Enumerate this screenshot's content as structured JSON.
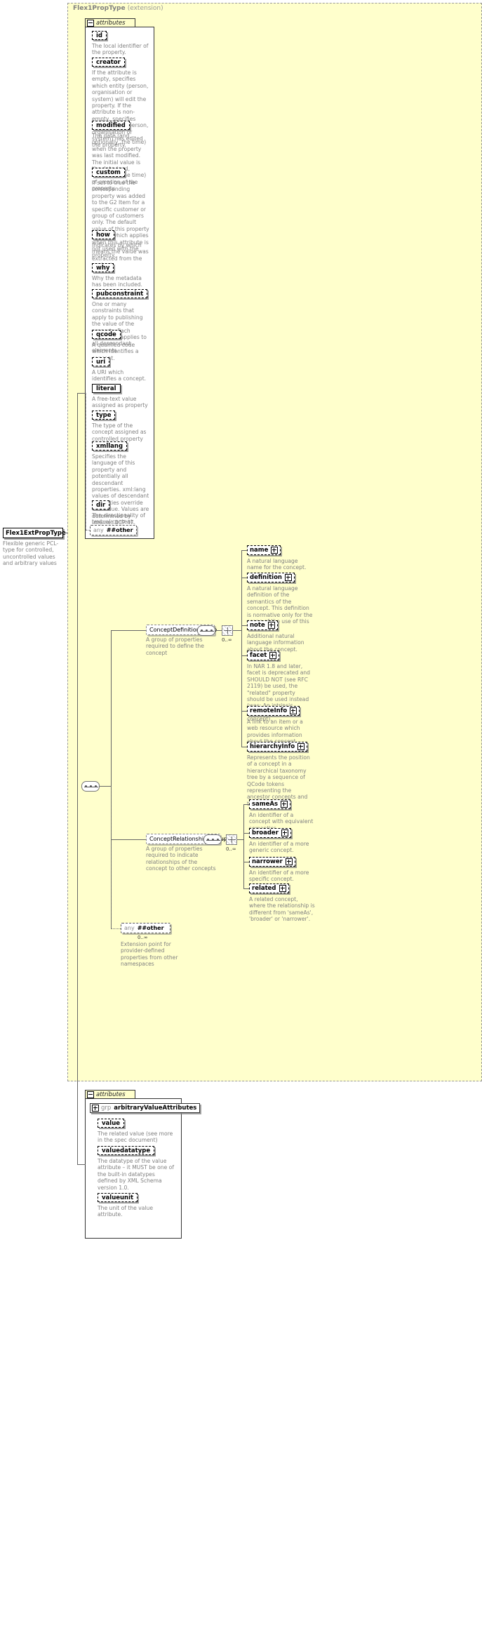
{
  "diagram": {
    "type": "xsd-schema-documentation",
    "root_type": {
      "label": "Flex1ExtPropType",
      "description": "Flexible generic PCL-type for controlled, uncontrolled values and arbitrary values"
    },
    "base_type_panel": {
      "title": "Flex1PropType",
      "qualifier": "(extension)"
    },
    "attributes_section_label": "attributes",
    "attributes": [
      {
        "name": "id",
        "description": "The local identifier of the property."
      },
      {
        "name": "creator",
        "description": "If the attribute is empty, specifies which entity (person, organisation or system) will edit the property. If the attribute is non-empty, specifies which entity (person, organisation or system) has edited the property."
      },
      {
        "name": "modified",
        "description": "The date (and, optionally, the time) when the property was last modified. The initial value is the date (and, optionally, the time) of creation of the property."
      },
      {
        "name": "custom",
        "description": "If set to true the corresponding property was added to the G2 Item for a specific customer or group of customers only. The default value of this property is false which applies when this attribute is not used with the property."
      },
      {
        "name": "how",
        "description": "Indicates by which means the value was extracted from the content."
      },
      {
        "name": "why",
        "description": "Why the metadata has been included."
      },
      {
        "name": "pubconstraint",
        "description": "One or many constraints that apply to publishing the value of the property. Each constraint applies to all descendant elements."
      },
      {
        "name": "qcode",
        "description": "A qualified code which identifies a concept."
      },
      {
        "name": "uri",
        "description": "A URI which identifies a concept."
      },
      {
        "name": "literal",
        "description": "A free-text value assigned as property value."
      },
      {
        "name": "type",
        "description": "The type of the concept assigned as controlled property value."
      },
      {
        "name": "xmllang",
        "description": "Specifies the language of this property and potentially all descendant properties. xml:lang values of descendant properties override this value. Values are determined by Internet BCP 47."
      },
      {
        "name": "dir",
        "description": "The directionality of textual content."
      }
    ],
    "attributes_any": {
      "any_label": "any",
      "namespace": "##other"
    },
    "content_model": {
      "groups": [
        {
          "name": "ConceptDefinitionGroup",
          "description": "A group of properties required to define the concept",
          "occurs": "0..∞",
          "members": [
            {
              "name": "name",
              "description": "A natural language name for the concept."
            },
            {
              "name": "definition",
              "description": "A natural language definition of the semantics of the concept. This definition is normative only for the scope of the use of this concept."
            },
            {
              "name": "note",
              "description": "Additional natural language information about the concept."
            },
            {
              "name": "facet",
              "description": "In NAR 1.8 and later, facet is deprecated and SHOULD NOT (see RFC 2119) be used, the \"related\" property should be used instead (was: An intrinsic property of the concept)."
            },
            {
              "name": "remoteInfo",
              "description": "A link to an item or a web resource which provides information about the concept"
            },
            {
              "name": "hierarchyInfo",
              "description": "Represents the position of a concept in a hierarchical taxonomy tree by a sequence of QCode tokens representing the ancestor concepts and this concept"
            }
          ]
        },
        {
          "name": "ConceptRelationshipsGroup",
          "description": "A group of properties required to indicate relationships of the concept to other concepts",
          "occurs": "0..∞",
          "members": [
            {
              "name": "sameAs",
              "description": "An identifier of a concept with equivalent semantics"
            },
            {
              "name": "broader",
              "description": "An identifier of a more generic concept."
            },
            {
              "name": "narrower",
              "description": "An identifier of a more specific concept."
            },
            {
              "name": "related",
              "description": "A related concept, where the relationship is different from 'sameAs', 'broader' or 'narrower'."
            }
          ]
        }
      ],
      "any": {
        "any_label": "any",
        "namespace": "##other",
        "occurs": "0..∞",
        "description": "Extension point for provider-defined properties from other namespaces"
      }
    },
    "bottom_attributes_section_label": "attributes",
    "attribute_group": {
      "kind_label": "grp",
      "name": "arbitraryValueAttributes",
      "attributes": [
        {
          "name": "value",
          "description": "The related value (see more in the spec document)"
        },
        {
          "name": "valuedatatype",
          "description": "The datatype of the value attribute – it MUST be one of the built-in datatypes defined by XML Schema version 1.0."
        },
        {
          "name": "valueunit",
          "description": "The unit of the value attribute."
        }
      ]
    },
    "icons": {
      "expander_minus": "minus-expander-icon",
      "expander_plus": "plus-expander-icon",
      "sequence": "sequence-compositor-icon",
      "choice": "choice-compositor-icon",
      "repeat": "repeat-occurrence-icon"
    },
    "colors": {
      "panel_bg": "#ffffcc",
      "page_bg": "#ffffff",
      "text": "#000000",
      "muted_text": "#808080",
      "border": "#333333",
      "link_blue": "#2b6cb0"
    }
  }
}
